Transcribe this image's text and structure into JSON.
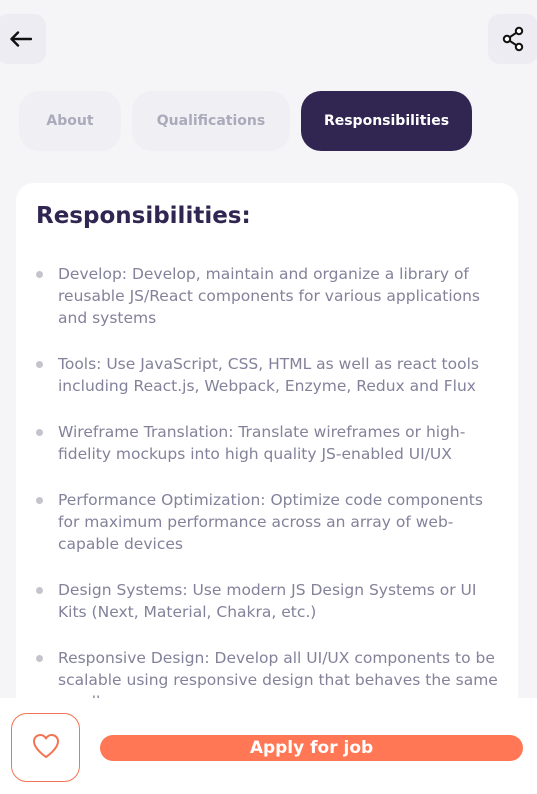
{
  "header": {
    "back_icon": "arrow-left-icon",
    "share_icon": "share-icon"
  },
  "tabs": [
    {
      "label": "About",
      "active": false
    },
    {
      "label": "Qualifications",
      "active": false
    },
    {
      "label": "Responsibilities",
      "active": true
    }
  ],
  "section": {
    "title": "Responsibilities:",
    "items": [
      "Develop: Develop, maintain and organize a library of reusable JS/React components for various applications and systems",
      "Tools: Use JavaScript, CSS, HTML as well as react tools including React.js, Webpack, Enzyme, Redux and Flux",
      "Wireframe Translation: Translate wireframes or high-fidelity mockups into high quality JS-enabled UI/UX",
      "Performance Optimization: Optimize code components for maximum performance across an array of web-capable devices",
      "Design Systems: Use modern JS Design Systems or UI Kits (Next, Material, Chakra, etc.)",
      "Responsive Design: Develop all UI/UX components to be scalable using responsive design that behaves the same on all"
    ]
  },
  "footer": {
    "favorite_icon": "heart-icon",
    "apply_label": "Apply for job"
  },
  "colors": {
    "primary": "#312651",
    "accent": "#ff7754",
    "text_gray": "#83829a",
    "tab_inactive_bg": "#f0f0f4"
  }
}
